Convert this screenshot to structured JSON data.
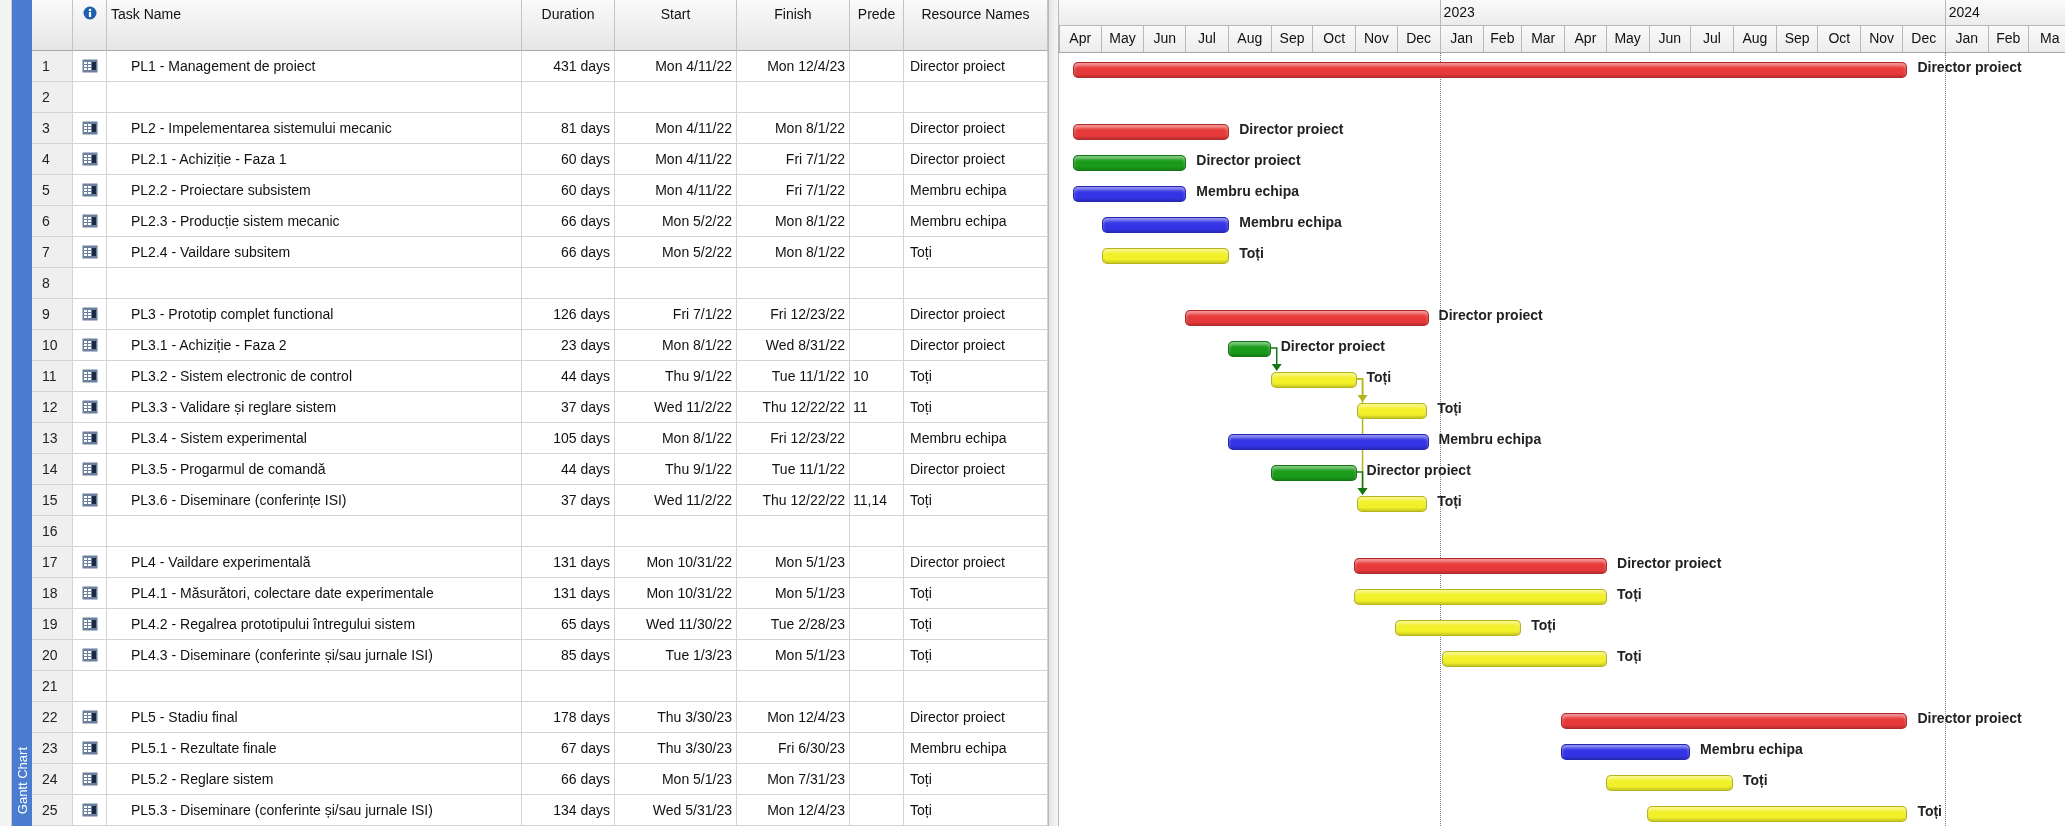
{
  "view_bar": {
    "label": "Gantt Chart"
  },
  "table": {
    "columns": [
      {
        "label": "Task Name"
      },
      {
        "label": "Duration"
      },
      {
        "label": "Start"
      },
      {
        "label": "Finish"
      },
      {
        "label": "Prede"
      },
      {
        "label": "Resource Names"
      }
    ],
    "rows": [
      {
        "number": "1",
        "task": "PL1 - Management de proiect",
        "duration": "431 days",
        "start": "Mon 4/11/22",
        "finish": "Mon 12/4/23",
        "resource": "Director proiect",
        "bar": {
          "color": "#e83a3a",
          "label": "Director proiect"
        }
      },
      {
        "number": "2"
      },
      {
        "number": "3",
        "task": "PL2 - Impelementarea sistemului mecanic",
        "duration": "81 days",
        "start": "Mon 4/11/22",
        "finish": "Mon 8/1/22",
        "resource": "Director proiect",
        "bar": {
          "color": "#e83a3a",
          "label": "Director proiect"
        }
      },
      {
        "number": "4",
        "task": "PL2.1 - Achiziție - Faza 1",
        "duration": "60 days",
        "start": "Mon 4/11/22",
        "finish": "Fri 7/1/22",
        "resource": "Director proiect",
        "bar": {
          "color": "#1a9c1a",
          "label": "Director proiect"
        }
      },
      {
        "number": "5",
        "task": "PL2.2 - Proiectare subsistem",
        "duration": "60 days",
        "start": "Mon 4/11/22",
        "finish": "Fri 7/1/22",
        "resource": "Membru echipa",
        "bar": {
          "color": "#3434e6",
          "label": "Membru echipa"
        }
      },
      {
        "number": "6",
        "task": "PL2.3 - Producție sistem mecanic",
        "duration": "66 days",
        "start": "Mon 5/2/22",
        "finish": "Mon 8/1/22",
        "resource": "Membru echipa",
        "bar": {
          "color": "#3434e6",
          "label": "Membru echipa"
        }
      },
      {
        "number": "7",
        "task": "PL2.4 - Vaildare subsitem",
        "duration": "66 days",
        "start": "Mon 5/2/22",
        "finish": "Mon 8/1/22",
        "resource": "Toți",
        "bar": {
          "color": "#f2f028",
          "label": "Toți"
        }
      },
      {
        "number": "8"
      },
      {
        "number": "9",
        "task": "PL3 - Prototip complet functional",
        "duration": "126 days",
        "start": "Fri 7/1/22",
        "finish": "Fri 12/23/22",
        "resource": "Director proiect",
        "bar": {
          "color": "#e83a3a",
          "label": "Director proiect"
        }
      },
      {
        "number": "10",
        "task": "PL3.1 - Achiziție - Faza 2",
        "duration": "23 days",
        "start": "Mon 8/1/22",
        "finish": "Wed 8/31/22",
        "resource": "Director proiect",
        "bar": {
          "color": "#1a9c1a",
          "label": "Director proiect"
        }
      },
      {
        "number": "11",
        "task": "PL3.2 - Sistem electronic de control",
        "duration": "44 days",
        "start": "Thu 9/1/22",
        "finish": "Tue 11/1/22",
        "predecessors": "10",
        "resource": "Toți",
        "bar": {
          "color": "#f2f028",
          "label": "Toți"
        }
      },
      {
        "number": "12",
        "task": "PL3.3 - Validare și reglare sistem",
        "duration": "37 days",
        "start": "Wed 11/2/22",
        "finish": "Thu 12/22/22",
        "predecessors": "11",
        "resource": "Toți",
        "bar": {
          "color": "#f2f028",
          "label": "Toți"
        }
      },
      {
        "number": "13",
        "task": "PL3.4 - Sistem experimental",
        "duration": "105 days",
        "start": "Mon 8/1/22",
        "finish": "Fri 12/23/22",
        "resource": "Membru echipa",
        "bar": {
          "color": "#3434e6",
          "label": "Membru echipa"
        }
      },
      {
        "number": "14",
        "task": "PL3.5 - Progarmul de comandă",
        "duration": "44 days",
        "start": "Thu 9/1/22",
        "finish": "Tue 11/1/22",
        "resource": "Director proiect",
        "bar": {
          "color": "#1a9c1a",
          "label": "Director proiect"
        }
      },
      {
        "number": "15",
        "task": "PL3.6 - Diseminare (conferințe ISI)",
        "duration": "37 days",
        "start": "Wed 11/2/22",
        "finish": "Thu 12/22/22",
        "predecessors": "11,14",
        "resource": "Toți",
        "bar": {
          "color": "#f2f028",
          "label": "Toți"
        }
      },
      {
        "number": "16"
      },
      {
        "number": "17",
        "task": "PL4 - Vaildare experimentală",
        "duration": "131 days",
        "start": "Mon 10/31/22",
        "finish": "Mon 5/1/23",
        "resource": "Director proiect",
        "bar": {
          "color": "#e83a3a",
          "label": "Director proiect"
        }
      },
      {
        "number": "18",
        "task": "PL4.1 - Măsurători, colectare date experimentale",
        "duration": "131 days",
        "start": "Mon 10/31/22",
        "finish": "Mon 5/1/23",
        "resource": "Toți",
        "bar": {
          "color": "#f2f028",
          "label": "Toți"
        }
      },
      {
        "number": "19",
        "task": "PL4.2 - Regalrea prototipului întregului sistem",
        "duration": "65 days",
        "start": "Wed 11/30/22",
        "finish": "Tue 2/28/23",
        "resource": "Toți",
        "bar": {
          "color": "#f2f028",
          "label": "Toți"
        }
      },
      {
        "number": "20",
        "task": "PL4.3 - Diseminare (conferinte și/sau jurnale ISI)",
        "duration": "85 days",
        "start": "Tue 1/3/23",
        "finish": "Mon 5/1/23",
        "resource": "Toți",
        "bar": {
          "color": "#f2f028",
          "label": "Toți"
        }
      },
      {
        "number": "21"
      },
      {
        "number": "22",
        "task": "PL5 - Stadiu final",
        "duration": "178 days",
        "start": "Thu 3/30/23",
        "finish": "Mon 12/4/23",
        "resource": "Director proiect",
        "bar": {
          "color": "#e83a3a",
          "label": "Director proiect"
        }
      },
      {
        "number": "23",
        "task": "PL5.1 - Rezultate finale",
        "duration": "67 days",
        "start": "Thu 3/30/23",
        "finish": "Fri 6/30/23",
        "resource": "Membru echipa",
        "bar": {
          "color": "#3434e6",
          "label": "Membru echipa"
        }
      },
      {
        "number": "24",
        "task": "PL5.2 - Reglare sistem",
        "duration": "66 days",
        "start": "Mon 5/1/23",
        "finish": "Mon 7/31/23",
        "resource": "Toți",
        "bar": {
          "color": "#f2f028",
          "label": "Toți"
        }
      },
      {
        "number": "25",
        "task": "PL5.3 - Diseminare (conferinte și/sau jurnale ISI)",
        "duration": "134 days",
        "start": "Wed 5/31/23",
        "finish": "Mon 12/4/23",
        "resource": "Toți",
        "bar": {
          "color": "#f2f028",
          "label": "Toți"
        }
      }
    ]
  },
  "timescale": {
    "months": [
      {
        "label": "Apr"
      },
      {
        "label": "May"
      },
      {
        "label": "Jun"
      },
      {
        "label": "Jul"
      },
      {
        "label": "Aug"
      },
      {
        "label": "Sep"
      },
      {
        "label": "Oct"
      },
      {
        "label": "Nov"
      },
      {
        "label": "Dec"
      },
      {
        "label": "Jan",
        "year": "2023"
      },
      {
        "label": "Feb"
      },
      {
        "label": "Mar"
      },
      {
        "label": "Apr"
      },
      {
        "label": "May"
      },
      {
        "label": "Jun"
      },
      {
        "label": "Jul"
      },
      {
        "label": "Aug"
      },
      {
        "label": "Sep"
      },
      {
        "label": "Oct"
      },
      {
        "label": "Nov"
      },
      {
        "label": "Dec"
      },
      {
        "label": "Jan",
        "year": "2024"
      },
      {
        "label": "Feb"
      },
      {
        "label": "Ma"
      }
    ]
  }
}
